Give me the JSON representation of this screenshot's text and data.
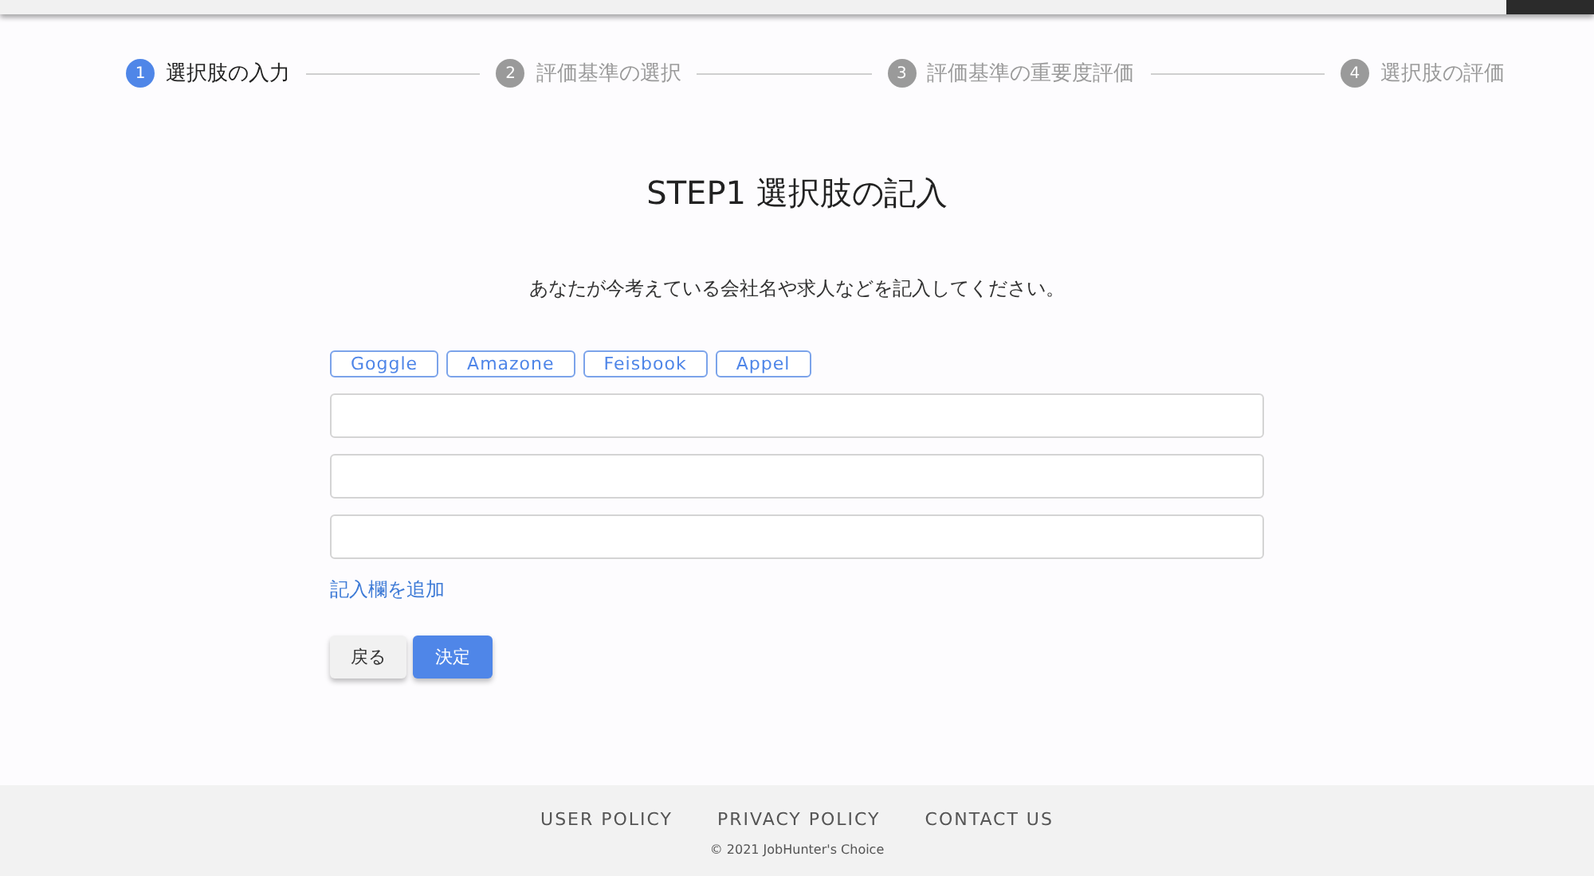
{
  "steps": [
    {
      "number": "1",
      "label": "選択肢の入力",
      "selected": true
    },
    {
      "number": "2",
      "label": "評価基準の選択",
      "selected": false
    },
    {
      "number": "3",
      "label": "評価基準の重要度評価",
      "selected": false
    },
    {
      "number": "4",
      "label": "選択肢の評価",
      "selected": false
    }
  ],
  "title": "STEP1 選択肢の記入",
  "instruction": "あなたが今考えている会社名や求人などを記入してください。",
  "suggestions": [
    "Goggle",
    "Amazone",
    "Feisbook",
    "Appel"
  ],
  "fields": [
    {
      "kind": "text"
    },
    {
      "kind": "text"
    },
    {
      "kind": "text"
    }
  ],
  "add_field_link": "記入欄を追加",
  "buttons": [
    {
      "label": "戻る",
      "kind": "secondary"
    },
    {
      "label": "決定",
      "kind": "primary"
    }
  ],
  "footer": {
    "links": [
      "USER POLICY",
      "PRIVACY POLICY",
      "CONTACT US"
    ],
    "copyright": "© 2021 JobHunter's Choice"
  }
}
